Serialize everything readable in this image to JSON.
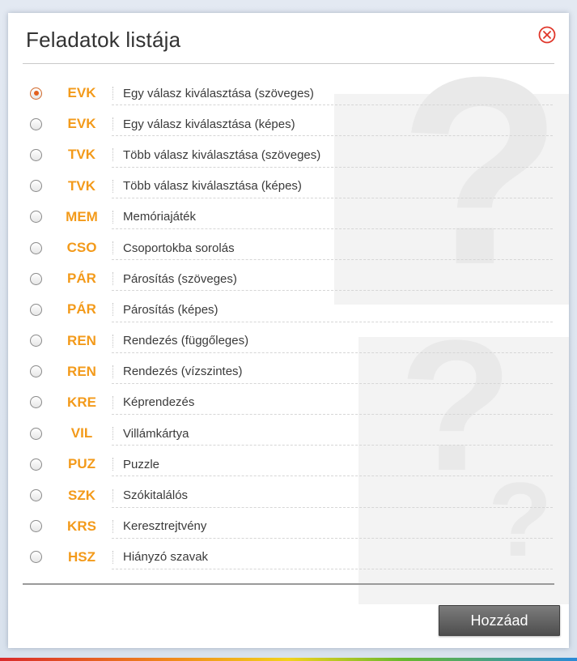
{
  "dialog": {
    "title": "Feladatok listája",
    "close_icon": "close-circle-icon",
    "add_button_label": "Hozzáad",
    "selected_index": 0
  },
  "colors": {
    "code": "#f39a1a",
    "close": "#e0362a",
    "radio_selected": "#e2601e"
  },
  "tasks": [
    {
      "code": "EVK",
      "label": "Egy válasz kiválasztása (szöveges)"
    },
    {
      "code": "EVK",
      "label": "Egy válasz kiválasztása (képes)"
    },
    {
      "code": "TVK",
      "label": "Több válasz kiválasztása (szöveges)"
    },
    {
      "code": "TVK",
      "label": "Több válasz kiválasztása (képes)"
    },
    {
      "code": "MEM",
      "label": "Memóriajáték"
    },
    {
      "code": "CSO",
      "label": "Csoportokba sorolás"
    },
    {
      "code": "PÁR",
      "label": "Párosítás (szöveges)"
    },
    {
      "code": "PÁR",
      "label": "Párosítás (képes)"
    },
    {
      "code": "REN",
      "label": "Rendezés (függőleges)"
    },
    {
      "code": "REN",
      "label": "Rendezés (vízszintes)"
    },
    {
      "code": "KRE",
      "label": "Képrendezés"
    },
    {
      "code": "VIL",
      "label": "Villámkártya"
    },
    {
      "code": "PUZ",
      "label": "Puzzle"
    },
    {
      "code": "SZK",
      "label": "Szókitalálós"
    },
    {
      "code": "KRS",
      "label": "Keresztrejtvény"
    },
    {
      "code": "HSZ",
      "label": "Hiányzó szavak"
    }
  ]
}
